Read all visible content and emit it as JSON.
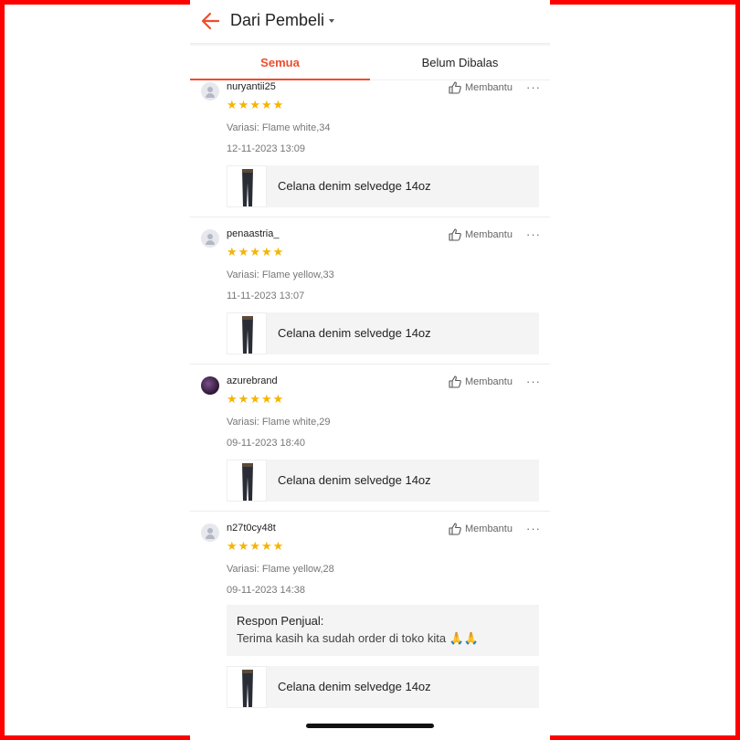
{
  "header": {
    "title": "Dari Pembeli"
  },
  "tabs": [
    {
      "label": "Semua",
      "active": true
    },
    {
      "label": "Belum Dibalas",
      "active": false
    }
  ],
  "colors": {
    "accent": "#ee4d2d",
    "star": "#f5b400",
    "frame": "#ff0000"
  },
  "reviews": [
    {
      "username": "nuryantii25",
      "rating": 5,
      "variation": "Variasi: Flame white,34",
      "date": "12-11-2023 13:09",
      "helpful_label": "Membantu",
      "product_name": "Celana denim selvedge 14oz",
      "avatar": "default-avatar-icon"
    },
    {
      "username": "penaastria_",
      "rating": 5,
      "variation": "Variasi: Flame yellow,33",
      "date": "11-11-2023 13:07",
      "helpful_label": "Membantu",
      "product_name": "Celana denim selvedge 14oz",
      "avatar": "default-avatar-icon"
    },
    {
      "username": "azurebrand",
      "rating": 5,
      "variation": "Variasi: Flame white,29",
      "date": "09-11-2023 18:40",
      "helpful_label": "Membantu",
      "product_name": "Celana denim selvedge 14oz",
      "avatar": "user-photo"
    },
    {
      "username": "n27t0cy48t",
      "rating": 5,
      "variation": "Variasi: Flame yellow,28",
      "date": "09-11-2023 14:38",
      "helpful_label": "Membantu",
      "product_name": "Celana denim selvedge 14oz",
      "avatar": "default-avatar-icon",
      "seller_response": {
        "title": "Respon Penjual:",
        "text": "Terima kasih ka sudah order di toko kita 🙏🙏"
      }
    }
  ]
}
